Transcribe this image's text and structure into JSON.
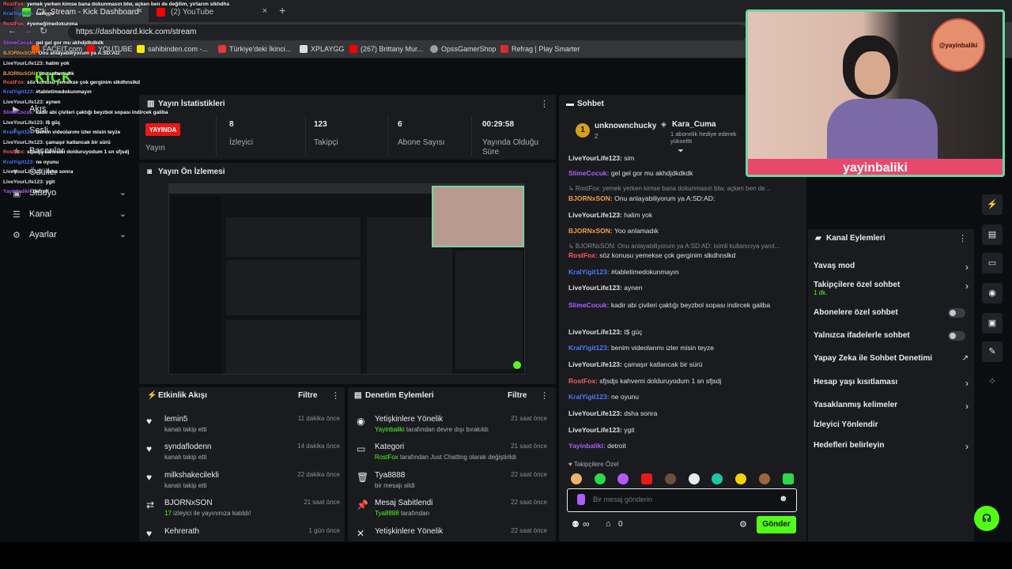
{
  "browser": {
    "tabs": [
      {
        "title": "Ck_Stream - Kick Dashboard",
        "close": "×"
      },
      {
        "title": "(2) YouTube",
        "close": "×"
      }
    ],
    "new_tab": "+",
    "url": "https://dashboard.kick.com/stream",
    "bookmarks": [
      "FACEIT.com",
      "YOUTUBE",
      "sahibinden.com -...",
      "Türkiye'deki İkinci...",
      "XPLAYGG",
      "(267) Brittany Mur...",
      "OpssGamerShop",
      "Refrag | Play Smarter"
    ]
  },
  "sidebar": {
    "logo": "KICK",
    "items": [
      {
        "label": "Akış",
        "icon": "▶"
      },
      {
        "label": "Sesli",
        "icon": "♪"
      },
      {
        "label": "Başarılar",
        "icon": "★"
      },
      {
        "label": "Ödüller",
        "icon": "♥"
      },
      {
        "label": "Stüdyo",
        "icon": "▣"
      },
      {
        "label": "Kanal",
        "icon": "☰"
      },
      {
        "label": "Ayarlar",
        "icon": "⚙"
      }
    ]
  },
  "stats": {
    "title": "Yayın İstatistikleri",
    "live_badge": "YAYINDA",
    "items": [
      {
        "value": "",
        "label": "Yayın"
      },
      {
        "value": "8",
        "label": "İzleyici"
      },
      {
        "value": "123",
        "label": "Takipçi"
      },
      {
        "value": "6",
        "label": "Abone Sayısı"
      },
      {
        "value": "00:29:58",
        "label": "Yayında Olduğu Süre"
      }
    ]
  },
  "preview": {
    "title": "Yayın Ön İzlemesi"
  },
  "activity": {
    "title": "Etkinlik Akışı",
    "filter": "Filtre",
    "items": [
      {
        "name": "lemin5",
        "desc": "kanalı takip etti",
        "time": "11 dakika önce",
        "icon": "♥"
      },
      {
        "name": "syndaflodenn",
        "desc": "kanalı takip etti",
        "time": "14 dakika önce",
        "icon": "♥"
      },
      {
        "name": "milkshakecilekli",
        "desc": "kanalı takip etti",
        "time": "22 dakika önce",
        "icon": "♥"
      },
      {
        "name": "BJORNxSON",
        "desc_green": "17",
        "desc": "izleyici ile yayınınıza katıldı!",
        "time": "21 saat önce",
        "icon": "⇄"
      },
      {
        "name": "Kehrerath",
        "desc": "",
        "time": "1 gün önce",
        "icon": "♥"
      }
    ]
  },
  "moderation": {
    "title": "Denetim Eylemleri",
    "filter": "Filtre",
    "items": [
      {
        "name": "Yetişkinlere Yönelik",
        "desc_green": "Yayinbaliki",
        "desc": "tarafından devre dışı bırakıldı",
        "time": "21 saat önce",
        "icon": "◉"
      },
      {
        "name": "Kategori",
        "desc_green": "RostFox",
        "desc": "tarafından Just Chatting olarak değiştirildi",
        "time": "21 saat önce",
        "icon": "▭"
      },
      {
        "name": "Tya8888",
        "desc": "bir mesajı sildi",
        "time": "22 saat önce",
        "icon": "🗑"
      },
      {
        "name": "Mesaj Sabitlendi",
        "desc_green": "Tya8888",
        "desc": "tarafından",
        "time": "22 saat önce",
        "icon": "📌"
      },
      {
        "name": "Yetişkinlere Yönelik",
        "desc": "",
        "time": "22 saat önce",
        "icon": "✕"
      }
    ]
  },
  "chat": {
    "title": "Sohbet",
    "pinned_user": "unknownchucky",
    "pinned_count": "2",
    "gifter_name": "Kara_Cuma",
    "gifter_text": "1 abonelik hediye ederek yükseltti",
    "messages": [
      {
        "user": "LiveYourLife123:",
        "text": "sim",
        "color": "#dfe2e5"
      },
      {
        "user": "SlimeCocuk:",
        "text": "gel gel gor mu akhdjdkdkdk",
        "color": "#b05cff"
      },
      {
        "user": "",
        "text": "↳ RostFox: yemek yerken kimse bana dokunmasın btw, açken ben de...",
        "color": "#868b91",
        "dim": true
      },
      {
        "user": "BJORNxSON:",
        "text": "Onu anlayabiliyorum ya A:SD:AD:",
        "color": "#f39c3d"
      },
      {
        "user": "LiveYourLife123:",
        "text": "halim yok",
        "color": "#dfe2e5"
      },
      {
        "user": "BJORNxSON:",
        "text": "Yoo anlamadık",
        "color": "#f39c3d"
      },
      {
        "user": "",
        "text": "↳ BJORNxSON: Onu anlayabiliyorum ya A:SD:AD: isimli kullanıcıya yanıt...",
        "color": "#868b91",
        "dim": true
      },
      {
        "user": "RostFox:",
        "text": "söz konusu yemekse çok gerginim slkdhnslkd",
        "color": "#ff5b5b"
      },
      {
        "user": "KralYigit123:",
        "text": "#tabletimedokunmayın",
        "color": "#4a7cff"
      },
      {
        "user": "LiveYourLife123:",
        "text": "aynen",
        "color": "#dfe2e5"
      },
      {
        "user": "SlimeCocuk:",
        "text": "kadir abi çivileri çaktığı beyzbol sopası indircek galiba",
        "color": "#b05cff"
      },
      {
        "user": "LiveYourLife123:",
        "text": "I$ güç",
        "color": "#dfe2e5"
      },
      {
        "user": "KralYigit123:",
        "text": "benim videolarımı izler misin teyze",
        "color": "#4a7cff"
      },
      {
        "user": "LiveYourLife123:",
        "text": "çamaşır katlancak bir sürü",
        "color": "#dfe2e5"
      },
      {
        "user": "RostFox:",
        "text": "sfjsdjs kahvemi dolduruyodum 1 sn sfjsdj",
        "color": "#ff5b5b"
      },
      {
        "user": "KralYigit123:",
        "text": "ne oyunu",
        "color": "#4a7cff"
      },
      {
        "user": "LiveYourLife123:",
        "text": "dsha sonra",
        "color": "#dfe2e5"
      },
      {
        "user": "LiveYourLife123:",
        "text": "ygit",
        "color": "#dfe2e5"
      },
      {
        "user": "Yayinbaliki:",
        "text": "detroit",
        "color": "#b05cff"
      }
    ],
    "followers_only_label": "Takipçilere Özel",
    "input_placeholder": "Bir mesaj gönderin",
    "points": "0",
    "send_label": "Gönder"
  },
  "channel_actions": {
    "title": "Kanal Eylemleri",
    "items": [
      {
        "label": "Yavaş mod",
        "kind": "chevron"
      },
      {
        "label": "Takipçilere özel sohbet",
        "sub": "1 dk.",
        "kind": "chevron"
      },
      {
        "label": "Abonelere özel sohbet",
        "kind": "toggle"
      },
      {
        "label": "Yalnızca ifadelerle sohbet",
        "kind": "toggle"
      },
      {
        "label": "Yapay Zeka ile Sohbet Denetimi",
        "kind": "external"
      },
      {
        "label": "Hesap yaşı kısıtlaması",
        "kind": "chevron"
      },
      {
        "label": "Yasaklanmış kelimeler",
        "kind": "chevron"
      },
      {
        "label": "İzleyici Yönlendir",
        "kind": "none"
      },
      {
        "label": "Hedefleri belirleyin",
        "kind": "chevron"
      }
    ]
  },
  "overlay_chat": [
    {
      "user": "RostFox:",
      "text": "yemek yerken kimse bana dokunmasın btw, açken ben de değilim, yırtarım slkhdhs",
      "color": "#ff5b5b"
    },
    {
      "user": "KralYigit123:",
      "text": "canooo",
      "color": "#4a7cff"
    },
    {
      "user": "RostFox:",
      "text": "#yemeğimedokunma",
      "color": "#ff5b5b"
    },
    {
      "user": "SlimeCocuk:",
      "text": "gel gel gor mu akhdjdkdkdk",
      "color": "#b05cff"
    },
    {
      "user": "BJORNxSON:",
      "text": "Onu anlayabiliyorum ya A:SD:AD:",
      "color": "#f39c3d"
    },
    {
      "user": "LiveYourLife123:",
      "text": "halim yok",
      "color": "#dfe2e5"
    },
    {
      "user": "BJORNxSON:",
      "text": "Yoo anlamadık",
      "color": "#f39c3d"
    },
    {
      "user": "RostFox:",
      "text": "söz konusu yemekse çok gerginim slkdhnslkd",
      "color": "#ff5b5b"
    },
    {
      "user": "KralYigit123:",
      "text": "#tabletimedokunmayın",
      "color": "#4a7cff"
    },
    {
      "user": "LiveYourLife123:",
      "text": "aynen",
      "color": "#dfe2e5"
    },
    {
      "user": "SlimeCocuk:",
      "text": "kadir abi çivileri çaktığı beyzbol sopası indircek galiba",
      "color": "#b05cff"
    },
    {
      "user": "LiveYourLife123:",
      "text": "I$ güç",
      "color": "#dfe2e5"
    },
    {
      "user": "KralYigit123:",
      "text": "benim videolarımı izler misin teyze",
      "color": "#4a7cff"
    },
    {
      "user": "LiveYourLife123:",
      "text": "çamaşır katlancak bir sürü",
      "color": "#dfe2e5"
    },
    {
      "user": "RostFox:",
      "text": "sfjsdjs kahvemi dolduruyodum 1 sn sfjsdj",
      "color": "#ff5b5b"
    },
    {
      "user": "KralYigit123:",
      "text": "ne oyunu",
      "color": "#4a7cff"
    },
    {
      "user": "LiveYourLife123:",
      "text": "dsha sonra",
      "color": "#dfe2e5"
    },
    {
      "user": "LiveYourLife123:",
      "text": "ygit",
      "color": "#dfe2e5"
    },
    {
      "user": "Yayinbaliki:",
      "text": "detroit",
      "color": "#b05cff"
    }
  ],
  "webcam": {
    "name_banner": "yayinbaliki",
    "logo_text": "@yayinbaliki"
  },
  "colors": {
    "accent": "#53fc18",
    "live": "#e91916",
    "panel": "#191b1f"
  }
}
